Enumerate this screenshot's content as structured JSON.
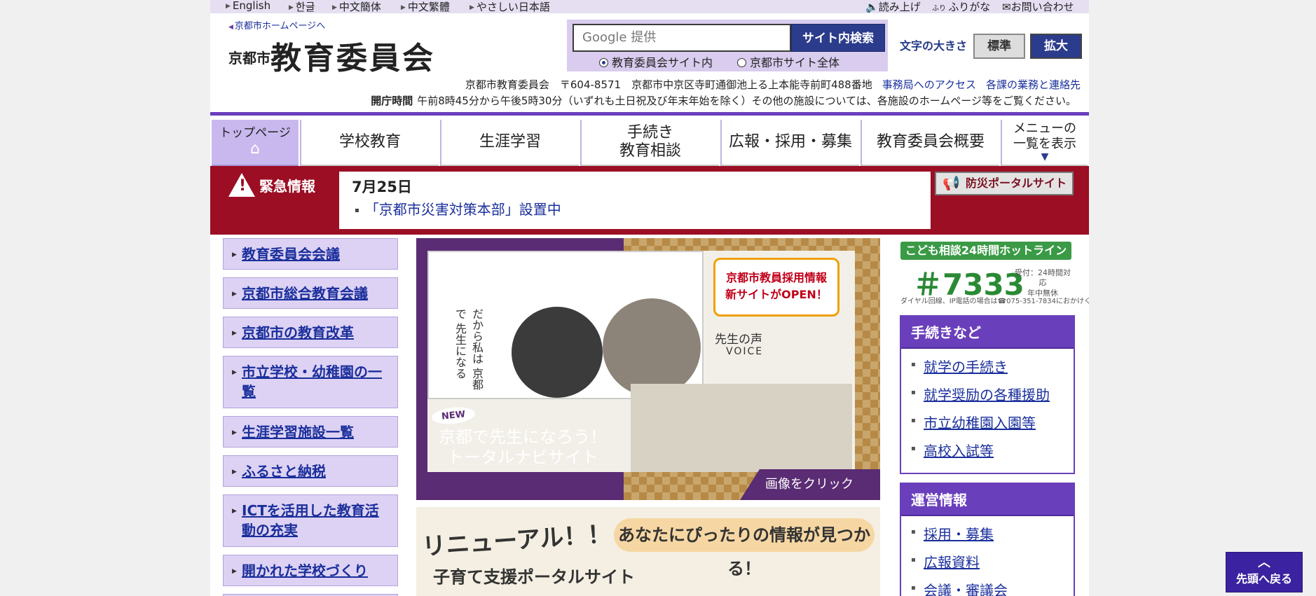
{
  "topbar": {
    "languages": [
      "English",
      "한글",
      "中文簡体",
      "中文繁體",
      "やさしい日本語"
    ],
    "read_aloud": "読み上げ",
    "furigana": "ふりがな",
    "contact": "お問い合わせ"
  },
  "header": {
    "city_link": "京都市ホームページへ",
    "logo_small": "京都市",
    "logo_large": "教育委員会",
    "search": {
      "placeholder": "Google 提供",
      "button": "サイト内検索",
      "scope_options": [
        "教育委員会サイト内",
        "京都市サイト全体"
      ],
      "scope_selected": 0
    },
    "font_size_label": "文字の大きさ",
    "font_standard": "標準",
    "font_large": "拡大",
    "address": "京都市教育委員会　〒604-8571　京都市中京区寺町通御池上る上本能寺前町488番地",
    "access_link": "事務局へのアクセス",
    "contacts_link": "各課の業務と連絡先",
    "hours_label": "開庁時間",
    "hours_text": "午前8時45分から午後5時30分（いずれも土日祝及び年末年始を除く）その他の施設については、各施設のホームページ等をご覧ください。"
  },
  "nav": {
    "top": "トップページ",
    "items": [
      "学校教育",
      "生涯学習",
      "手続き\n教育相談",
      "広報・採用・募集",
      "教育委員会概要"
    ],
    "menu": "メニューの\n一覧を表示"
  },
  "alert": {
    "label": "緊急情報",
    "date": "7月25日",
    "item": "「京都市災害対策本部」設置中",
    "portal_button": "防災ポータルサイト"
  },
  "leftnav": [
    "教育委員会会議",
    "京都市総合教育会議",
    "京都市の教育改革",
    "市立学校・幼稚園の一覧",
    "生涯学習施設一覧",
    "ふるさと納税",
    "ICTを活用した教育活動の充実",
    "開かれた学校づくり"
  ],
  "banner1": {
    "new_tag": "NEW",
    "title": "京都で先生になろう！\nトータルナビサイト",
    "tag": "京都市教員採用情報\n新サイトがOPEN！",
    "voice": "先生の声",
    "voice_en": "VOICE",
    "vertical_text": "だから私は 京都で 先生になる",
    "click": "画像をクリック"
  },
  "banner2": {
    "renewal": "リニューアル！！",
    "bubble": "あなたにぴったりの情報が見つかる！",
    "subtitle": "子育て支援ポータルサイト"
  },
  "hotline": {
    "heading": "こども相談24時間ホットライン",
    "number": "＃7333",
    "note": "受付：24時間対応\n年中無休",
    "tel_note": "ダイヤル回線、IP電話の場合は☎075-351-7834におかけください。"
  },
  "sidebox_procedures": {
    "heading": "手続きなど",
    "items": [
      "就学の手続き",
      "就学奨励の各種援助",
      "市立幼稚園入園等",
      "高校入試等"
    ]
  },
  "sidebox_operations": {
    "heading": "運営情報",
    "items": [
      "採用・募集",
      "広報資料",
      "会議・審議会"
    ]
  },
  "back_to_top": "先頭へ戻る",
  "colors": {
    "accent": "#6a3fbc",
    "alert_red": "#9b0e24",
    "nav_blue": "#2c3c8c",
    "link": "#1a2f9c",
    "hotline_green": "#3a9a46"
  }
}
